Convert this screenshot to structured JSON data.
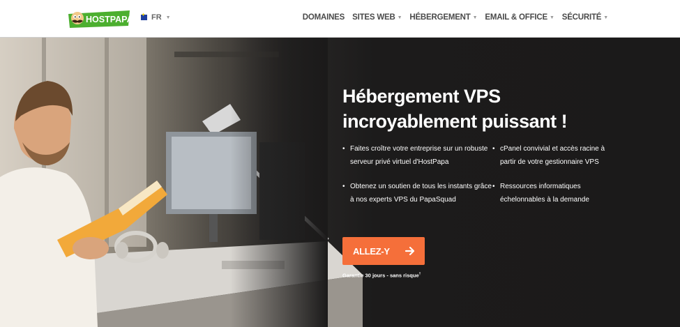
{
  "header": {
    "logo_text": "HOSTPAPA",
    "language": "FR",
    "nav": [
      {
        "label": "DOMAINES",
        "has_dropdown": false
      },
      {
        "label": "SITES WEB",
        "has_dropdown": true
      },
      {
        "label": "HÉBERGEMENT",
        "has_dropdown": true
      },
      {
        "label": "EMAIL & OFFICE",
        "has_dropdown": true
      },
      {
        "label": "SÉCURITÉ",
        "has_dropdown": true
      }
    ]
  },
  "hero": {
    "title_line1": "Hébergement VPS",
    "title_line2": "incroyablement puissant !",
    "bullets": [
      {
        "line1": "Faites croître votre entreprise sur un robuste",
        "line2": "serveur privé virtuel d'HostPapa"
      },
      {
        "line1": "cPanel convivial et accès racine à",
        "line2": "partir de votre gestionnaire VPS"
      },
      {
        "line1": "Obtenez un soutien de tous les instants grâce",
        "line2": "à nos experts VPS du PapaSquad"
      },
      {
        "line1": "Ressources informatiques",
        "line2": "échelonnables à la demande"
      }
    ],
    "cta_label": "ALLEZ-Y",
    "guarantee": "Garantie 30 jours - sans risque",
    "guarantee_mark": "†"
  },
  "colors": {
    "accent": "#f56f3a",
    "logo_green": "#4caf2f",
    "hero_dark": "#1b1a1a",
    "nav_text": "#4a4a4a"
  },
  "icons": {
    "flag": "eu-flag-icon",
    "dropdown": "chevron-down-icon",
    "cta": "arrow-right-icon"
  }
}
